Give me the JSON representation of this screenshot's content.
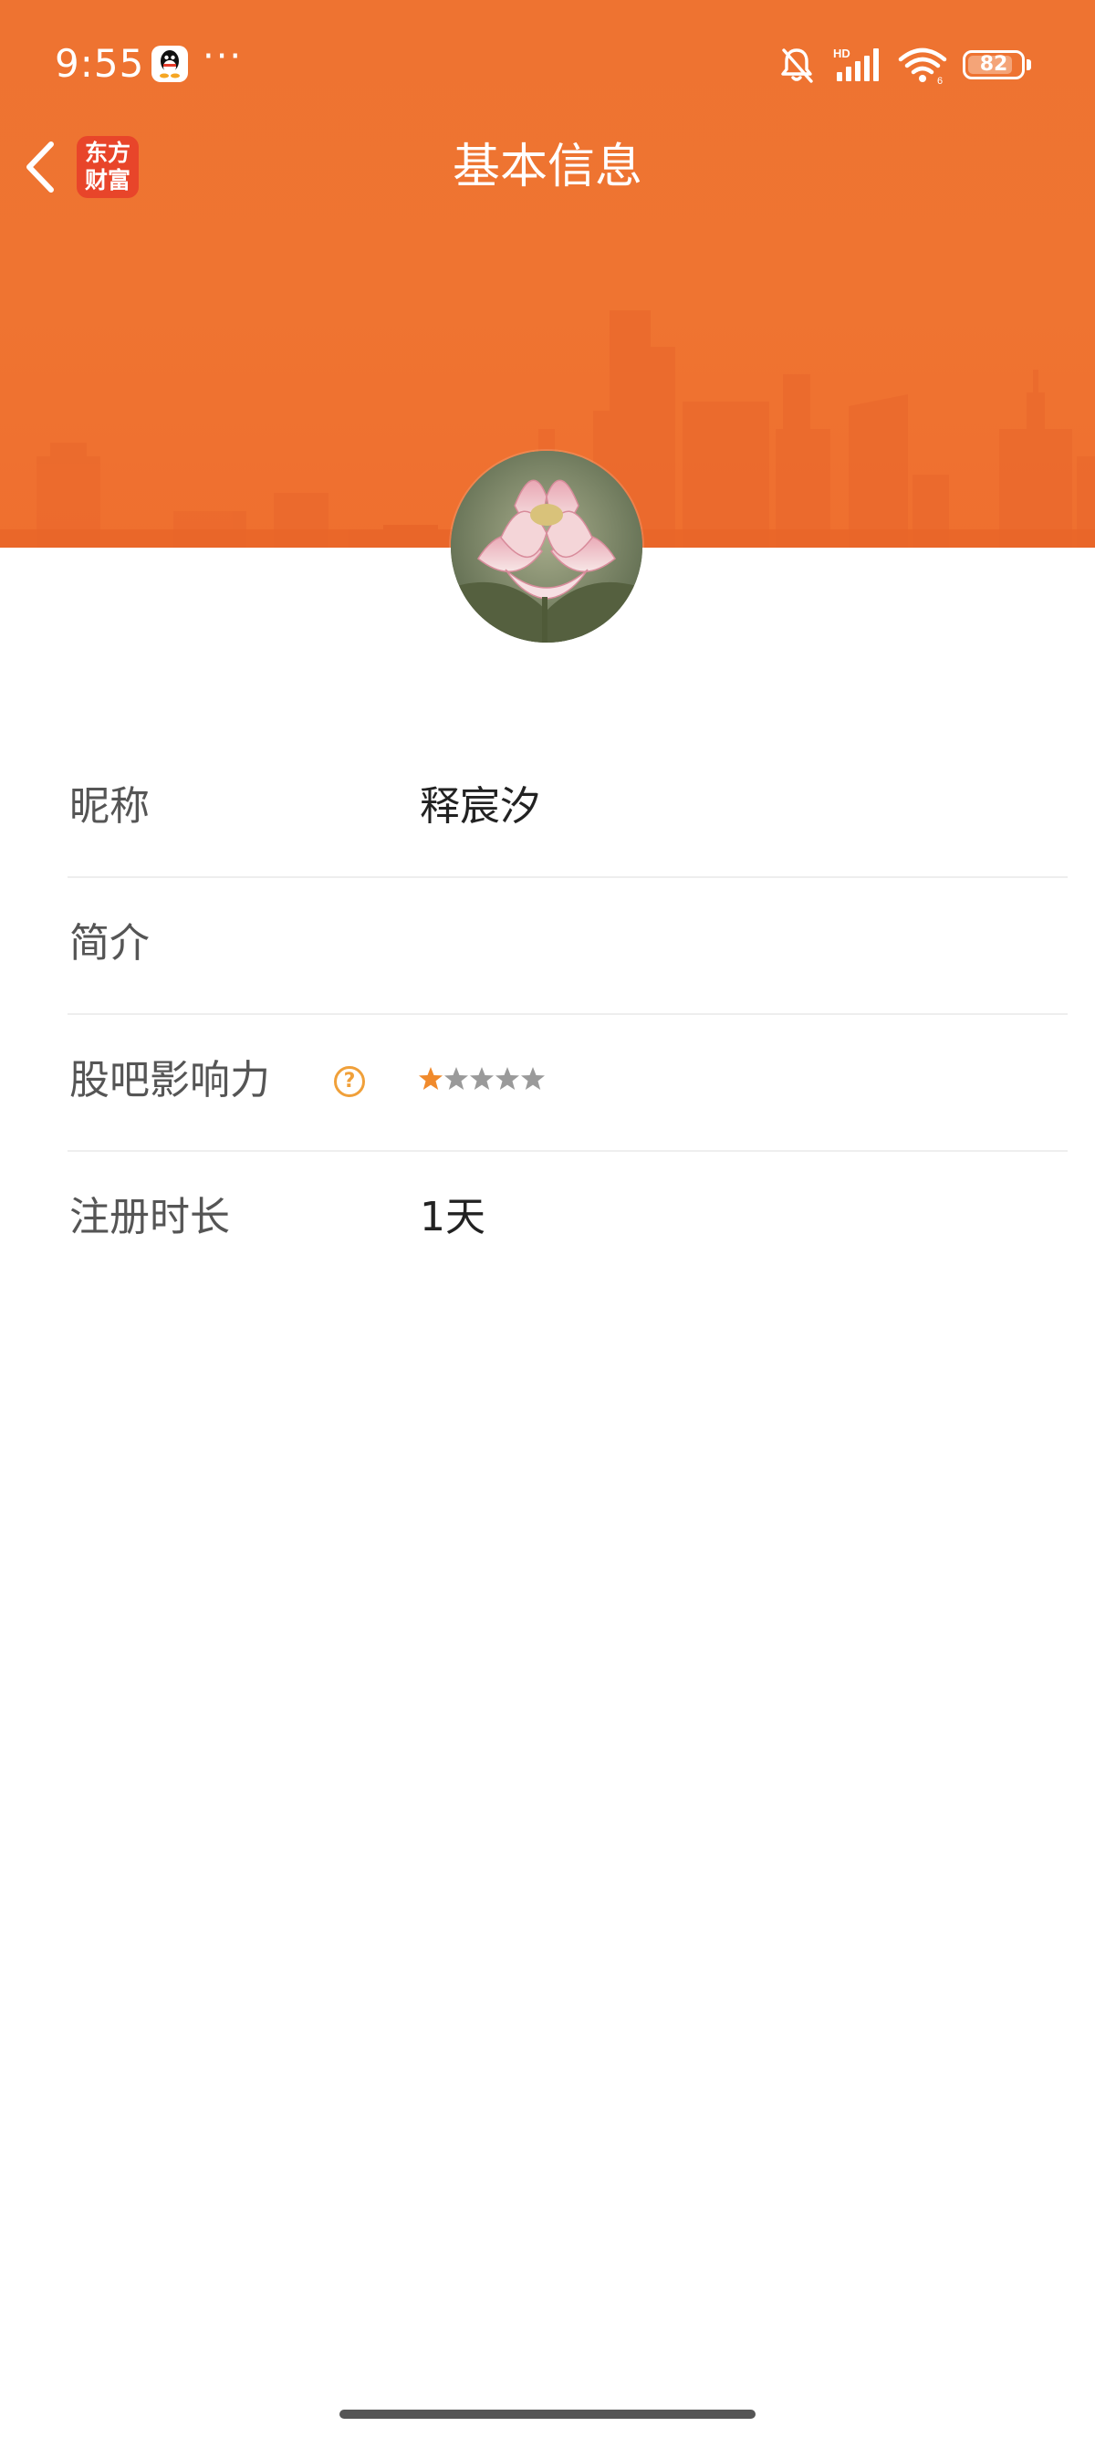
{
  "status_bar": {
    "time": "9:55",
    "more_dots": "···",
    "battery_level": "82",
    "icons": [
      "qq-icon",
      "mute-bell-icon",
      "hd-signal-icon",
      "wifi-icon",
      "battery-icon"
    ]
  },
  "nav": {
    "title": "基本信息",
    "back_icon": "chevron-left-icon",
    "brand_logo_line1": "东方",
    "brand_logo_line2": "财富"
  },
  "colors": {
    "header_orange": "#ee7331",
    "brand_red": "#e8452a",
    "star_active": "#f08a2c",
    "star_inactive": "#9a9a9a",
    "help_icon": "#f0a03a"
  },
  "profile": {
    "avatar_icon": "lotus-avatar-image",
    "rows": [
      {
        "label": "昵称",
        "value": "释宸汐"
      },
      {
        "label": "简介",
        "value": ""
      },
      {
        "label": "股吧影响力",
        "value": "",
        "rating": 1,
        "rating_max": 5,
        "help_icon": "question-circle-icon"
      },
      {
        "label": "注册时长",
        "value": "1天"
      }
    ]
  }
}
